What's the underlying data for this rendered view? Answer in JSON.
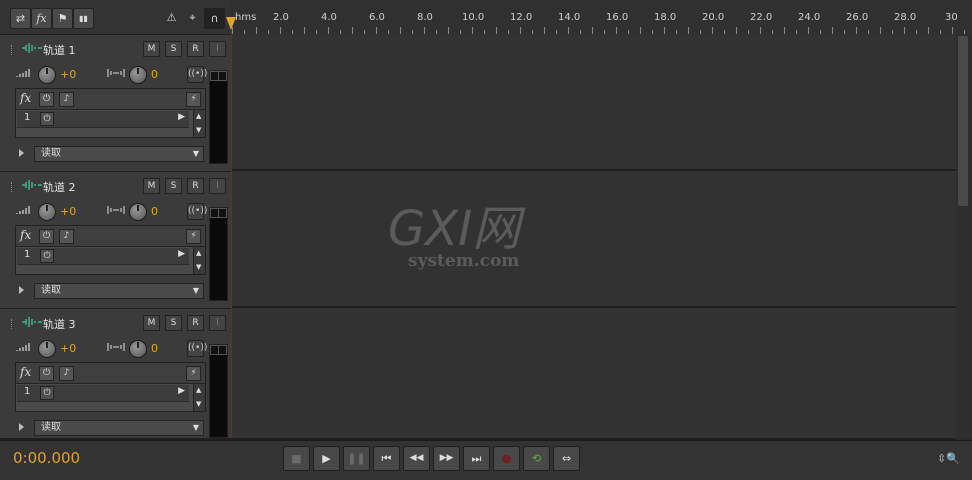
{
  "toolbar": {
    "buttons": [
      {
        "label": "⇄"
      },
      {
        "label": "fx"
      },
      {
        "label": "⚑"
      },
      {
        "label": "▮▮"
      }
    ],
    "right_buttons": [
      {
        "label": "⚠"
      },
      {
        "label": "⌖"
      },
      {
        "label": "∩"
      }
    ]
  },
  "ruler": {
    "unit": "hms",
    "ticks": [
      "2.0",
      "4.0",
      "6.0",
      "8.0",
      "10.0",
      "12.0",
      "14.0",
      "16.0",
      "18.0",
      "20.0",
      "22.0",
      "24.0",
      "26.0",
      "28.0",
      "30"
    ]
  },
  "tracks": [
    {
      "name": "轨道 1",
      "volume": "+0",
      "pan": "0",
      "slot_number": "1",
      "mode": "读取"
    },
    {
      "name": "轨道 2",
      "volume": "+0",
      "pan": "0",
      "slot_number": "1",
      "mode": "读取"
    },
    {
      "name": "轨道 3",
      "volume": "+0",
      "pan": "0",
      "slot_number": "1",
      "mode": "读取"
    }
  ],
  "track_buttons": {
    "mute": "M",
    "solo": "S",
    "record": "R",
    "input": "I"
  },
  "fx_label": "fx",
  "transport": {
    "time": "0:00.000",
    "buttons": [
      {
        "name": "stop",
        "label": "■"
      },
      {
        "name": "play",
        "label": "▶"
      },
      {
        "name": "pause",
        "label": "❚❚"
      },
      {
        "name": "go-to-start",
        "label": "⏮"
      },
      {
        "name": "rewind",
        "label": "◀◀"
      },
      {
        "name": "fast-forward",
        "label": "▶▶"
      },
      {
        "name": "go-to-end",
        "label": "⏭"
      },
      {
        "name": "record",
        "label": "●"
      },
      {
        "name": "loop",
        "label": "⟲"
      },
      {
        "name": "skip",
        "label": "⇔"
      }
    ],
    "zoom_label": "⇳🔍"
  },
  "watermark": {
    "brand": "GXI网",
    "domain": "system.com"
  },
  "colors": {
    "accent": "#e0a526",
    "playhead": "#8a1d1d",
    "wave": "#3cb88a"
  }
}
